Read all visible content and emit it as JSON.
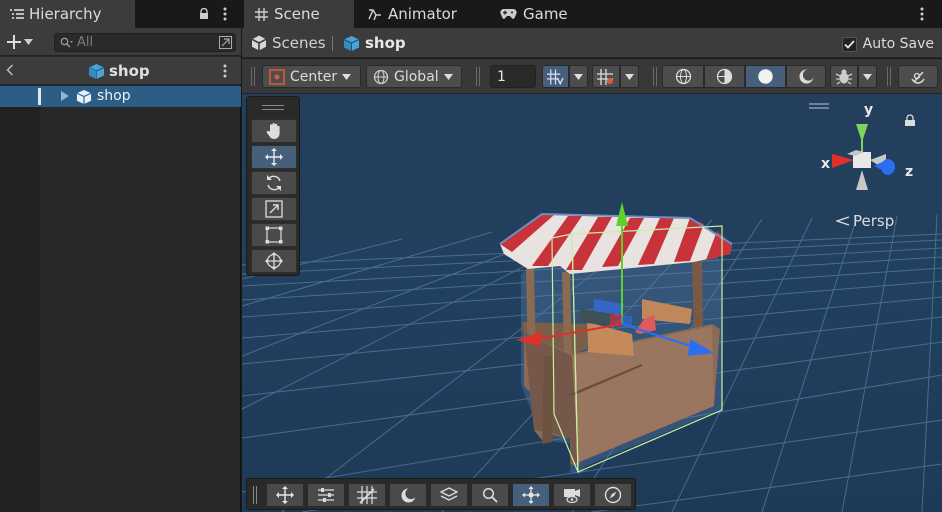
{
  "hierarchy": {
    "tab_label": "Hierarchy",
    "search_placeholder": "All",
    "header_title": "shop",
    "items": [
      {
        "label": "shop"
      }
    ]
  },
  "scene_tabs": [
    {
      "label": "Scene",
      "icon": "grid-icon"
    },
    {
      "label": "Animator",
      "icon": "animator-icon"
    },
    {
      "label": "Game",
      "icon": "gamepad-icon"
    }
  ],
  "breadcrumb": {
    "root": "Scenes",
    "current": "shop"
  },
  "autosave": {
    "label": "Auto Save",
    "checked": true
  },
  "toolbar": {
    "pivot_label": "Center",
    "space_label": "Global",
    "grid_snap_value": "1"
  },
  "viewport": {
    "projection_label": "Persp"
  },
  "gizmo": {
    "x_label": "x",
    "y_label": "y",
    "z_label": "z"
  },
  "colors": {
    "accent": "#2c5d87",
    "x_axis": "#e0302a",
    "y_axis": "#5fd12f",
    "z_axis": "#2a6ff0"
  }
}
